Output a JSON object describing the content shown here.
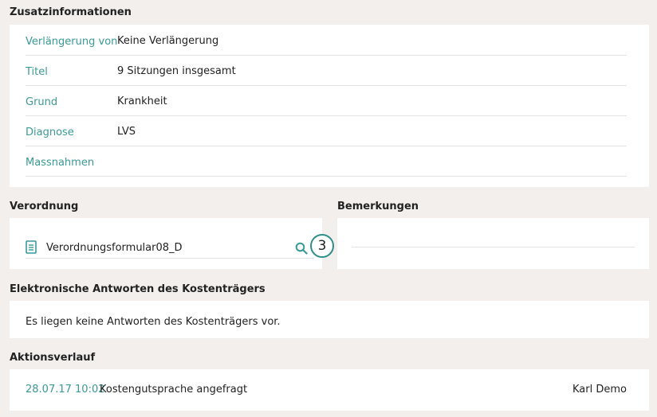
{
  "zusatz": {
    "title": "Zusatzinformationen",
    "rows": [
      {
        "label": "Verlängerung von",
        "value": "Keine Verlängerung"
      },
      {
        "label": "Titel",
        "value": "9 Sitzungen insgesamt"
      },
      {
        "label": "Grund",
        "value": "Krankheit"
      },
      {
        "label": "Diagnose",
        "value": "LVS"
      },
      {
        "label": "Massnahmen",
        "value": ""
      }
    ]
  },
  "verordnung": {
    "title": "Verordnung",
    "document_name": "Verordnungsformular08_D",
    "doc_icon": "document-icon",
    "search_icon": "search-icon",
    "step_badge": "3"
  },
  "bemerkungen": {
    "title": "Bemerkungen",
    "value": ""
  },
  "antworten": {
    "title": "Elektronische Antworten des Kostenträgers",
    "message": "Es liegen keine Antworten des Kostenträgers vor."
  },
  "aktionsverlauf": {
    "title": "Aktionsverlauf",
    "entries": [
      {
        "date": "28.07.17 10:02",
        "action": "Kostengutsprache angefragt",
        "user": "Karl Demo"
      }
    ]
  },
  "colors": {
    "accent": "#3a9a96",
    "background": "#f3efec",
    "panel": "#ffffff"
  }
}
